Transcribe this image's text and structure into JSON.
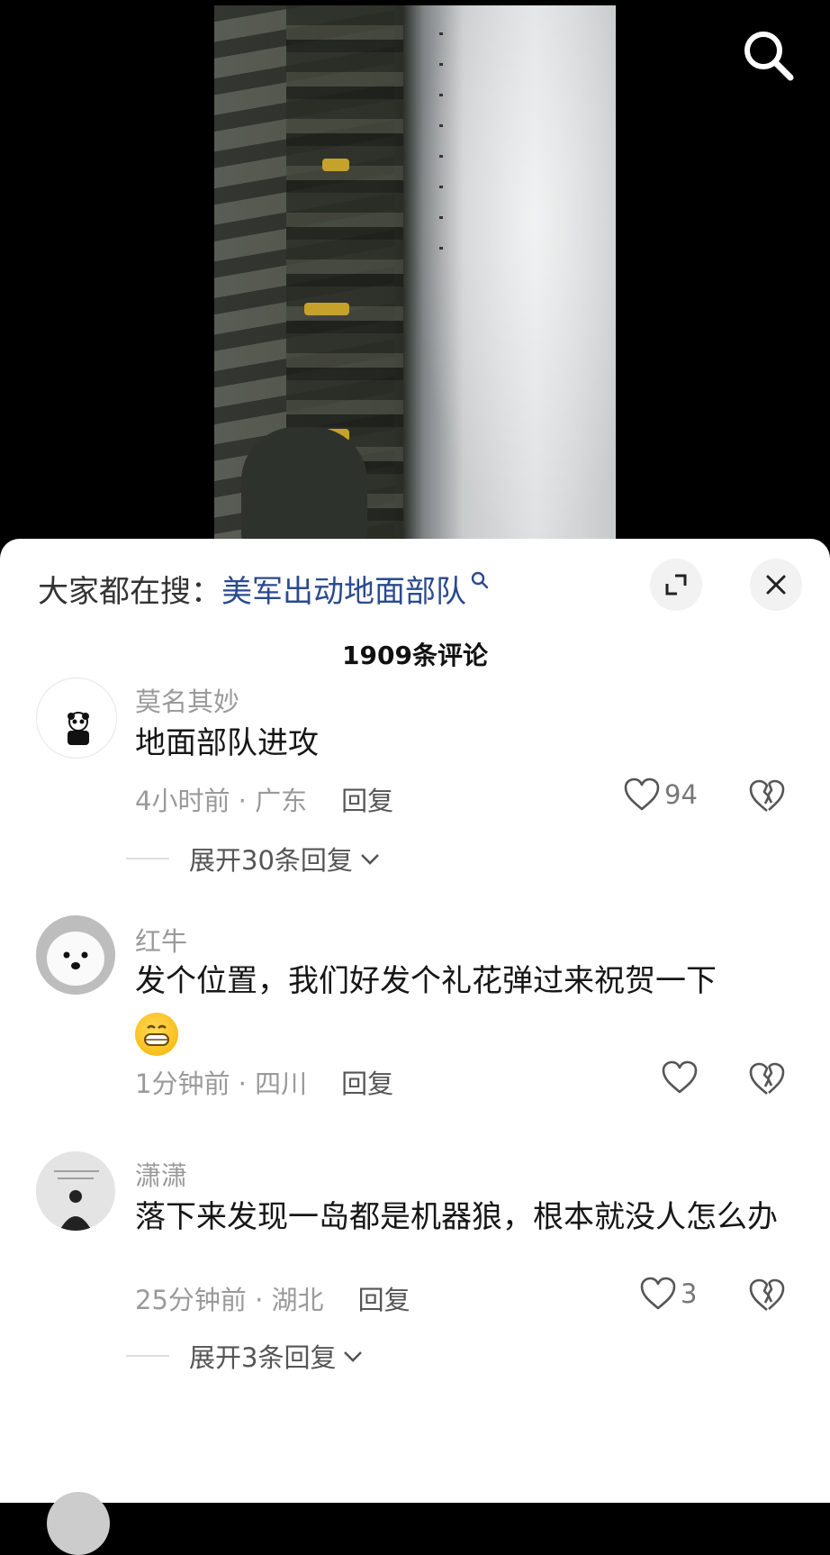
{
  "video": {
    "search_icon": "search-icon"
  },
  "sheet": {
    "suggest_prefix": "大家都在搜：",
    "suggest_query": "美军出动地面部队",
    "comment_count": "1909条评论"
  },
  "comments": [
    {
      "username": "莫名其妙",
      "text": "地面部队进攻",
      "time_location": "4小时前 · 广东",
      "reply_label": "回复",
      "likes": "94",
      "expand_label": "展开30条回复"
    },
    {
      "username": "红牛",
      "text": "发个位置，我们好发个礼花弹过来祝贺一下",
      "time_location": "1分钟前 · 四川",
      "reply_label": "回复",
      "likes": ""
    },
    {
      "username": "潇潇",
      "text": "落下来发现一岛都是机器狼，根本就没人怎么办",
      "time_location": "25分钟前 · 湖北",
      "reply_label": "回复",
      "likes": "3",
      "expand_label": "展开3条回复"
    }
  ],
  "colors": {
    "link": "#2b4a8e",
    "muted": "#9a9a9a",
    "text": "#161616"
  }
}
